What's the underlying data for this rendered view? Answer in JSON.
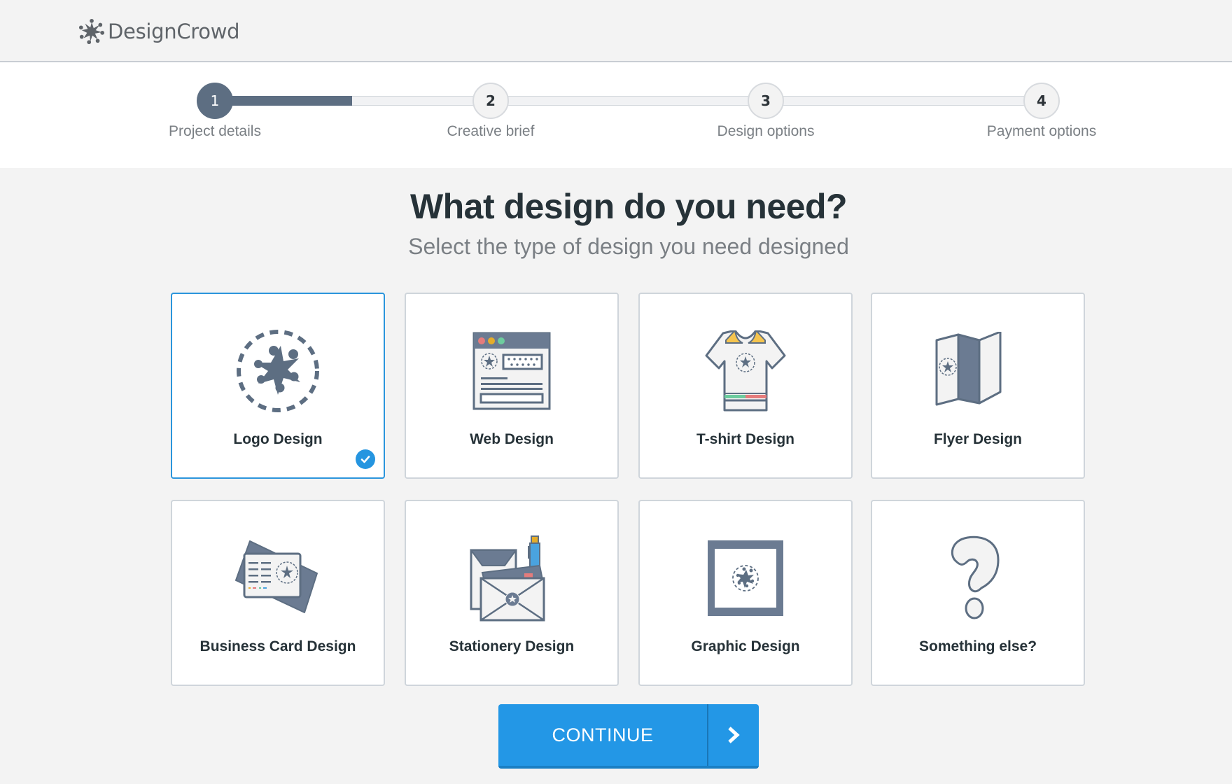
{
  "brand": {
    "name": "DesignCrowd",
    "icon": "designcrowd-star-logo"
  },
  "stepper": {
    "progress_to_next": 0.5,
    "steps": [
      {
        "number": "1",
        "label": "Project details",
        "state": "active"
      },
      {
        "number": "2",
        "label": "Creative brief",
        "state": "upcoming"
      },
      {
        "number": "3",
        "label": "Design options",
        "state": "upcoming"
      },
      {
        "number": "4",
        "label": "Payment options",
        "state": "upcoming"
      }
    ]
  },
  "main": {
    "title": "What design do you need?",
    "subtitle": "Select the type of design you need designed"
  },
  "options": [
    {
      "label": "Logo Design",
      "icon": "logo-design-icon",
      "selected": true
    },
    {
      "label": "Web Design",
      "icon": "web-design-icon",
      "selected": false
    },
    {
      "label": "T-shirt Design",
      "icon": "tshirt-design-icon",
      "selected": false
    },
    {
      "label": "Flyer Design",
      "icon": "flyer-design-icon",
      "selected": false
    },
    {
      "label": "Business Card Design",
      "icon": "business-card-design-icon",
      "selected": false
    },
    {
      "label": "Stationery Design",
      "icon": "stationery-design-icon",
      "selected": false
    },
    {
      "label": "Graphic Design",
      "icon": "graphic-design-icon",
      "selected": false
    },
    {
      "label": "Something else?",
      "icon": "question-mark-icon",
      "selected": false
    }
  ],
  "continue_button": {
    "label": "CONTINUE",
    "icon": "chevron-right-icon"
  },
  "colors": {
    "accent": "#2397e6",
    "slate": "#5d6e82",
    "selected_border": "#2b95dc",
    "background": "#f3f3f3"
  }
}
